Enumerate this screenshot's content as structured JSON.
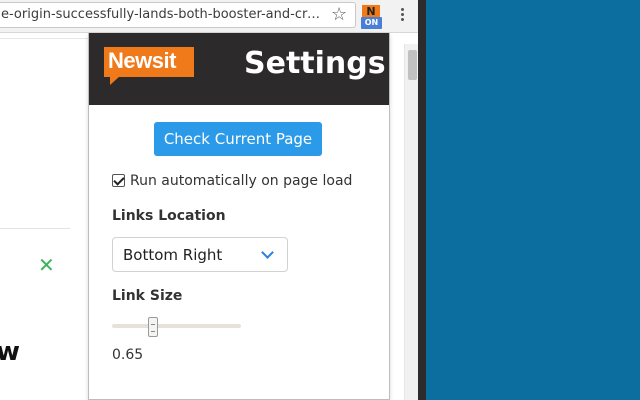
{
  "browser": {
    "url": "e-origin-successfully-lands-both-booster-and-cre…",
    "extension_icon_letter": "N",
    "extension_badge": "ON"
  },
  "popup": {
    "logo_text": "Newsit",
    "title": "Settings",
    "check_button_label": "Check Current Page",
    "auto_run": {
      "label": "Run automatically on page load",
      "checked": true
    },
    "links_location": {
      "label": "Links Location",
      "selected": "Bottom Right"
    },
    "link_size": {
      "label": "Link Size",
      "value": "0.65",
      "fraction": 0.3
    }
  },
  "page": {
    "partial_letter": "w"
  },
  "colors": {
    "brand_orange": "#f07a1a",
    "header_bg": "#2c2a2a",
    "button_blue": "#2b9ae9",
    "desktop_blue": "#0c6e9f"
  }
}
